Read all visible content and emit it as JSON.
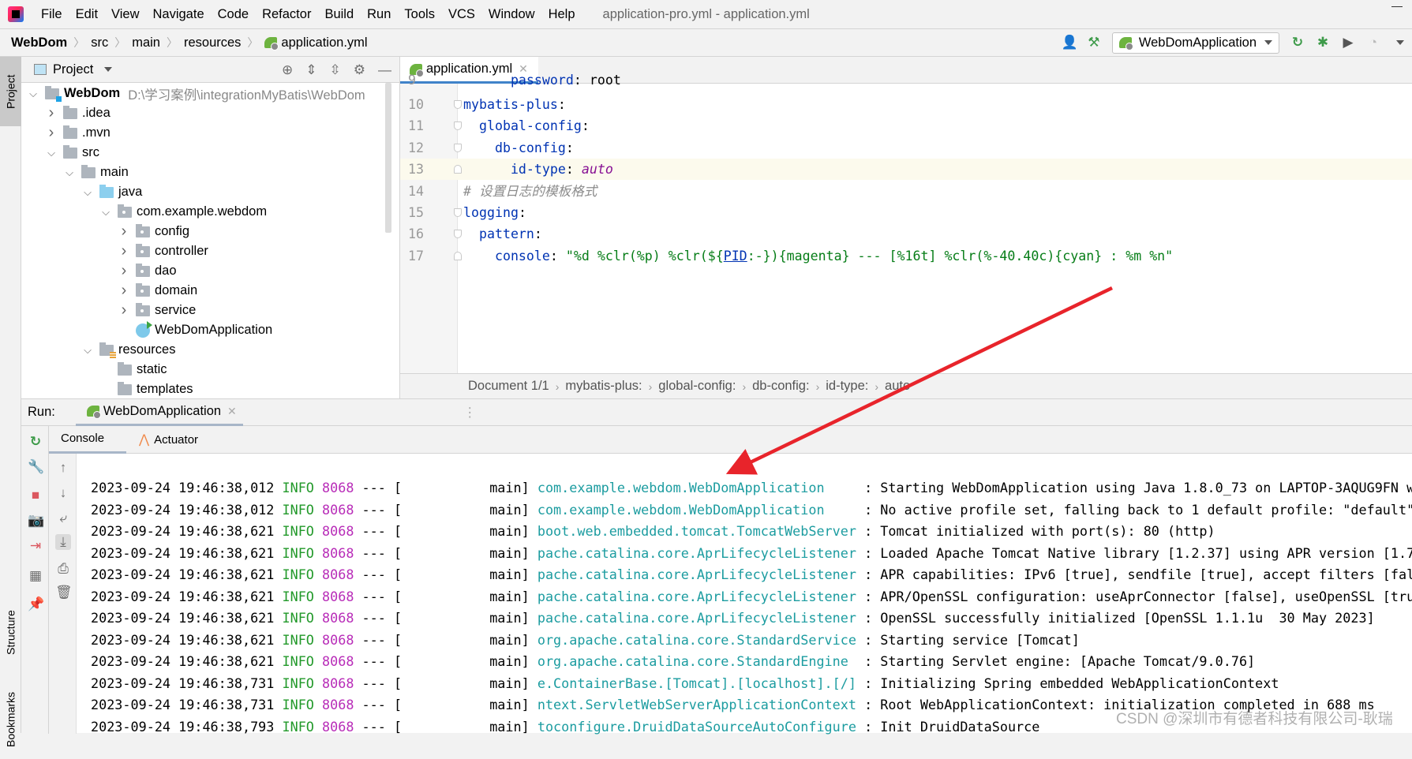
{
  "menubar": {
    "items": [
      "File",
      "Edit",
      "View",
      "Navigate",
      "Code",
      "Refactor",
      "Build",
      "Run",
      "Tools",
      "VCS",
      "Window",
      "Help"
    ],
    "window_title": "application-pro.yml - application.yml"
  },
  "navbar": {
    "crumbs": [
      "WebDom",
      "src",
      "main",
      "resources",
      "application.yml"
    ],
    "run_config": "WebDomApplication"
  },
  "left_stripe": {
    "project": "Project",
    "structure": "Structure",
    "bookmarks": "Bookmarks"
  },
  "project_panel": {
    "title": "Project",
    "tree": [
      {
        "label": "WebDom",
        "path": "D:\\学习案例\\integrationMyBatis\\WebDom",
        "depth": 0,
        "state": "expanded",
        "icon": "module-folder",
        "bold": true
      },
      {
        "label": ".idea",
        "depth": 1,
        "state": "collapsed",
        "icon": "folder"
      },
      {
        "label": ".mvn",
        "depth": 1,
        "state": "collapsed",
        "icon": "folder"
      },
      {
        "label": "src",
        "depth": 1,
        "state": "expanded",
        "icon": "folder"
      },
      {
        "label": "main",
        "depth": 2,
        "state": "expanded",
        "icon": "folder"
      },
      {
        "label": "java",
        "depth": 3,
        "state": "expanded",
        "icon": "source-folder"
      },
      {
        "label": "com.example.webdom",
        "depth": 4,
        "state": "expanded",
        "icon": "package"
      },
      {
        "label": "config",
        "depth": 5,
        "state": "collapsed",
        "icon": "package"
      },
      {
        "label": "controller",
        "depth": 5,
        "state": "collapsed",
        "icon": "package"
      },
      {
        "label": "dao",
        "depth": 5,
        "state": "collapsed",
        "icon": "package"
      },
      {
        "label": "domain",
        "depth": 5,
        "state": "collapsed",
        "icon": "package"
      },
      {
        "label": "service",
        "depth": 5,
        "state": "collapsed",
        "icon": "package"
      },
      {
        "label": "WebDomApplication",
        "depth": 5,
        "state": "leaf",
        "icon": "spring-boot-class"
      },
      {
        "label": "resources",
        "depth": 3,
        "state": "expanded",
        "icon": "resources-folder"
      },
      {
        "label": "static",
        "depth": 4,
        "state": "leaf",
        "icon": "folder"
      },
      {
        "label": "templates",
        "depth": 4,
        "state": "leaf",
        "icon": "folder"
      }
    ]
  },
  "editor": {
    "tab": "application.yml",
    "lines": [
      {
        "n": "9",
        "parts": [
          [
            "k",
            "      password"
          ],
          [
            "p",
            ": "
          ],
          [
            "p",
            "root"
          ]
        ]
      },
      {
        "n": "10",
        "parts": [
          [
            "k",
            "mybatis-plus"
          ],
          [
            "p",
            ":"
          ]
        ]
      },
      {
        "n": "11",
        "parts": [
          [
            "k",
            "  global-config"
          ],
          [
            "p",
            ":"
          ]
        ]
      },
      {
        "n": "12",
        "parts": [
          [
            "k",
            "    db-config"
          ],
          [
            "p",
            ":"
          ]
        ]
      },
      {
        "n": "13",
        "parts": [
          [
            "k",
            "      id-type"
          ],
          [
            "p",
            ": "
          ],
          [
            "v",
            "auto"
          ]
        ],
        "current": true
      },
      {
        "n": "14",
        "parts": [
          [
            "c",
            "# 设置日志的模板格式"
          ]
        ]
      },
      {
        "n": "15",
        "parts": [
          [
            "k",
            "logging"
          ],
          [
            "p",
            ":"
          ]
        ]
      },
      {
        "n": "16",
        "parts": [
          [
            "k",
            "  pattern"
          ],
          [
            "p",
            ":"
          ]
        ]
      },
      {
        "n": "17",
        "parts": [
          [
            "k",
            "    console"
          ],
          [
            "p",
            ": "
          ],
          [
            "s",
            "\"%d %clr(%p) %clr(${"
          ],
          [
            "u",
            "PID"
          ],
          [
            "s",
            ":-}){magenta} --- [%16t] %clr(%-40.40c){cyan} : %m %n\""
          ]
        ]
      }
    ],
    "status_crumbs": [
      "Document 1/1",
      "mybatis-plus:",
      "global-config:",
      "db-config:",
      "id-type:",
      "auto"
    ]
  },
  "run_panel": {
    "label": "Run:",
    "tab": "WebDomApplication",
    "console_tabs": [
      "Console",
      "Actuator"
    ],
    "log": [
      {
        "time": "2023-09-24 19:46:38,012",
        "level": "INFO",
        "pid": "8068",
        "thread": "main",
        "logger": "com.example.webdom.WebDomApplication",
        "msg": "Starting WebDomApplication using Java 1.8.0_73 on LAPTOP-3AQUG9FN wi"
      },
      {
        "time": "2023-09-24 19:46:38,012",
        "level": "INFO",
        "pid": "8068",
        "thread": "main",
        "logger": "com.example.webdom.WebDomApplication",
        "msg": "No active profile set, falling back to 1 default profile: \"default\""
      },
      {
        "time": "2023-09-24 19:46:38,621",
        "level": "INFO",
        "pid": "8068",
        "thread": "main",
        "logger": "boot.web.embedded.tomcat.TomcatWebServer",
        "msg": "Tomcat initialized with port(s): 80 (http)"
      },
      {
        "time": "2023-09-24 19:46:38,621",
        "level": "INFO",
        "pid": "8068",
        "thread": "main",
        "logger": "pache.catalina.core.AprLifecycleListener",
        "msg": "Loaded Apache Tomcat Native library [1.2.37] using APR version [1.7."
      },
      {
        "time": "2023-09-24 19:46:38,621",
        "level": "INFO",
        "pid": "8068",
        "thread": "main",
        "logger": "pache.catalina.core.AprLifecycleListener",
        "msg": "APR capabilities: IPv6 [true], sendfile [true], accept filters [fals"
      },
      {
        "time": "2023-09-24 19:46:38,621",
        "level": "INFO",
        "pid": "8068",
        "thread": "main",
        "logger": "pache.catalina.core.AprLifecycleListener",
        "msg": "APR/OpenSSL configuration: useAprConnector [false], useOpenSSL [true"
      },
      {
        "time": "2023-09-24 19:46:38,621",
        "level": "INFO",
        "pid": "8068",
        "thread": "main",
        "logger": "pache.catalina.core.AprLifecycleListener",
        "msg": "OpenSSL successfully initialized [OpenSSL 1.1.1u  30 May 2023]"
      },
      {
        "time": "2023-09-24 19:46:38,621",
        "level": "INFO",
        "pid": "8068",
        "thread": "main",
        "logger": "org.apache.catalina.core.StandardService",
        "msg": "Starting service [Tomcat]"
      },
      {
        "time": "2023-09-24 19:46:38,621",
        "level": "INFO",
        "pid": "8068",
        "thread": "main",
        "logger": "org.apache.catalina.core.StandardEngine",
        "msg": "Starting Servlet engine: [Apache Tomcat/9.0.76]"
      },
      {
        "time": "2023-09-24 19:46:38,731",
        "level": "INFO",
        "pid": "8068",
        "thread": "main",
        "logger": "e.ContainerBase.[Tomcat].[localhost].[/]",
        "msg": "Initializing Spring embedded WebApplicationContext"
      },
      {
        "time": "2023-09-24 19:46:38,731",
        "level": "INFO",
        "pid": "8068",
        "thread": "main",
        "logger": "ntext.ServletWebServerApplicationContext",
        "msg": "Root WebApplicationContext: initialization completed in 688 ms"
      },
      {
        "time": "2023-09-24 19:46:38,793",
        "level": "INFO",
        "pid": "8068",
        "thread": "main",
        "logger": "toconfigure.DruidDataSourceAutoConfigure",
        "msg": "Init DruidDataSource"
      }
    ]
  },
  "watermark": "CSDN @深圳市有德者科技有限公司-耿瑞",
  "colors": {
    "annotation_arrow": "#e8242b",
    "yaml_key": "#0033b3",
    "yaml_string": "#067d17",
    "log_level": "#22992a",
    "log_pid": "#b82cb8",
    "log_logger": "#1c9ca0"
  }
}
